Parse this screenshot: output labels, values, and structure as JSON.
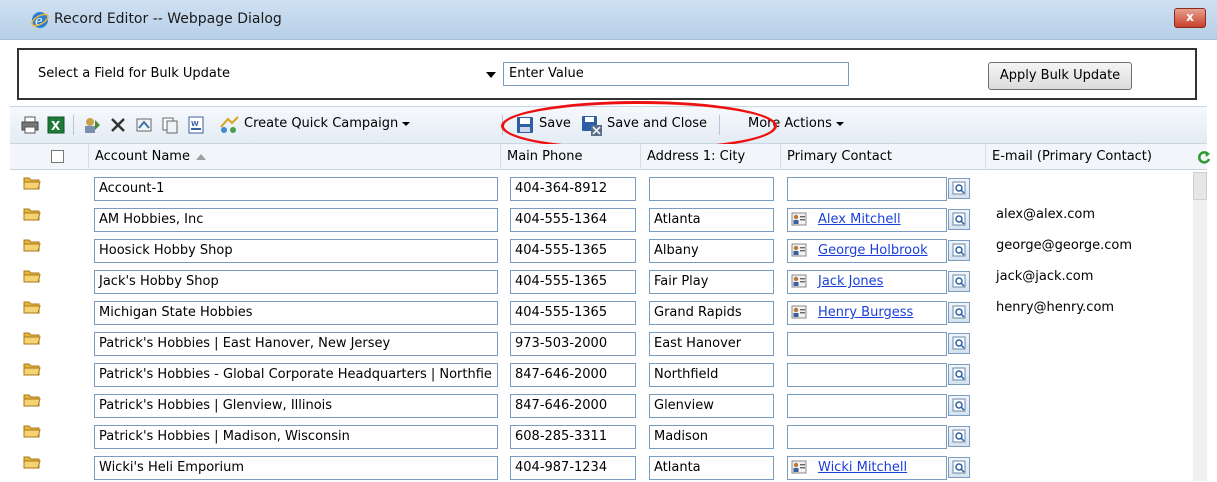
{
  "window": {
    "title": "Record Editor -- Webpage Dialog",
    "close_glyph": "x"
  },
  "bulk": {
    "field_select": "Select a Field for Bulk Update",
    "value_input": "Enter Value",
    "apply_button": "Apply Bulk Update"
  },
  "toolbar": {
    "create_quick_campaign": "Create Quick Campaign",
    "save": "Save",
    "save_and_close": "Save and Close",
    "more_actions": "More Actions"
  },
  "columns": {
    "account_name": "Account Name",
    "main_phone": "Main Phone",
    "city": "Address 1: City",
    "primary_contact": "Primary Contact",
    "email": "E-mail (Primary Contact)"
  },
  "rows": [
    {
      "name": "Account-1",
      "phone": "404-364-8912",
      "city": "",
      "contact": "",
      "email": ""
    },
    {
      "name": "AM Hobbies, Inc",
      "phone": "404-555-1364",
      "city": "Atlanta",
      "contact": "Alex Mitchell",
      "email": "alex@alex.com"
    },
    {
      "name": "Hoosick Hobby Shop",
      "phone": "404-555-1365",
      "city": "Albany",
      "contact": "George Holbrook",
      "email": "george@george.com"
    },
    {
      "name": "Jack's Hobby Shop",
      "phone": "404-555-1365",
      "city": "Fair Play",
      "contact": "Jack Jones",
      "email": "jack@jack.com"
    },
    {
      "name": "Michigan State Hobbies",
      "phone": "404-555-1365",
      "city": "Grand Rapids",
      "contact": "Henry Burgess",
      "email": "henry@henry.com"
    },
    {
      "name": "Patrick's Hobbies  | East Hanover, New Jersey",
      "phone": "973-503-2000",
      "city": "East Hanover",
      "contact": "",
      "email": ""
    },
    {
      "name": "Patrick's Hobbies - Global Corporate Headquarters | Northfie",
      "phone": "847-646-2000",
      "city": "Northfield",
      "contact": "",
      "email": ""
    },
    {
      "name": "Patrick's Hobbies | Glenview, Illinois",
      "phone": "847-646-2000",
      "city": "Glenview",
      "contact": "",
      "email": ""
    },
    {
      "name": "Patrick's Hobbies | Madison, Wisconsin",
      "phone": "608-285-3311",
      "city": "Madison",
      "contact": "",
      "email": ""
    },
    {
      "name": "Wicki's Heli Emporium",
      "phone": "404-987-1234",
      "city": "Atlanta",
      "contact": "Wicki Mitchell",
      "email": ""
    }
  ],
  "colors": {
    "link": "#1a3fd8",
    "highlight": "#e11111"
  }
}
